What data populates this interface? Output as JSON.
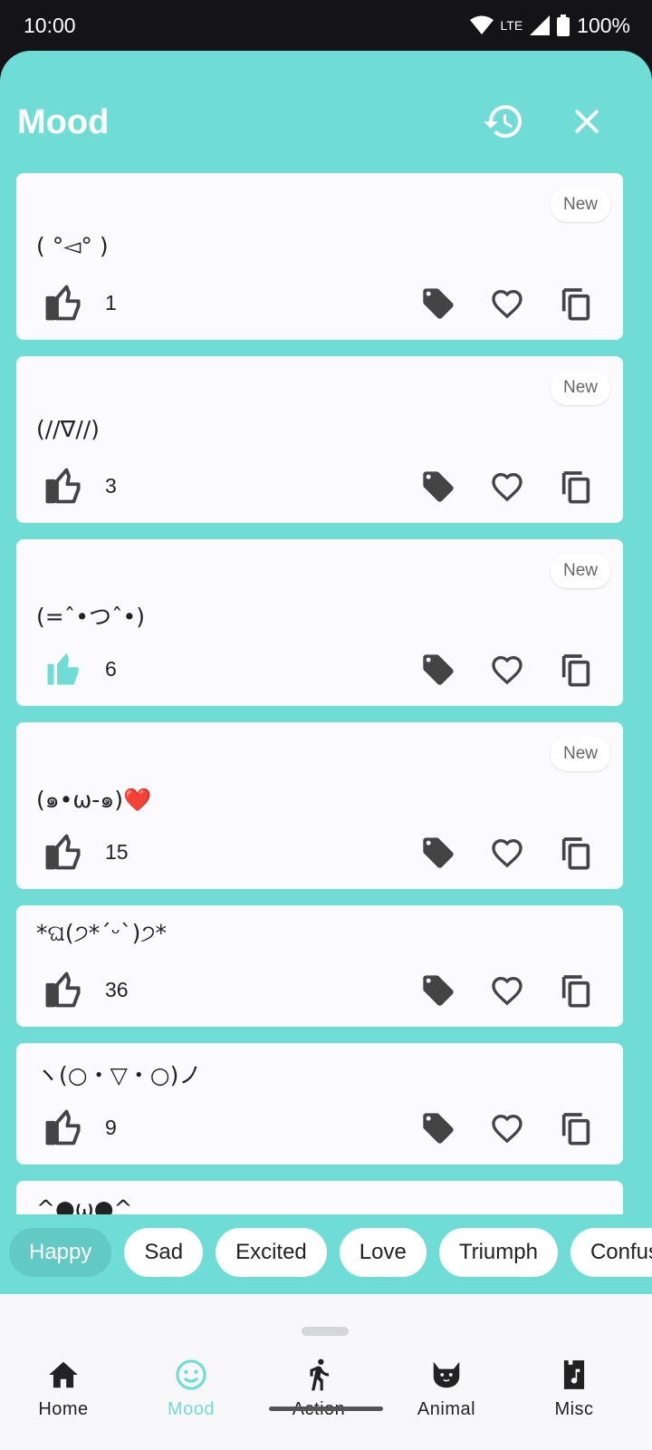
{
  "status": {
    "time": "10:00",
    "network": "LTE",
    "battery": "100%"
  },
  "header": {
    "title": "Mood"
  },
  "accent": "#6fdcd6",
  "cards": [
    {
      "kaomoji": "( °◅° )",
      "likes": "1",
      "badge": "New",
      "liked": false
    },
    {
      "kaomoji": "(//∇//)",
      "likes": "3",
      "badge": "New",
      "liked": false
    },
    {
      "kaomoji": "(=ˆ•つˆ•)",
      "likes": "6",
      "badge": "New",
      "liked": true
    },
    {
      "kaomoji": "(๑•ω-๑)❤️",
      "likes": "15",
      "badge": "New",
      "liked": false
    },
    {
      "kaomoji": "*ଘ(੭*ˊᵕˋ)੭*",
      "likes": "36",
      "liked": false
    },
    {
      "kaomoji": "ヽ(○・▽・○)ノ",
      "likes": "9",
      "liked": false
    },
    {
      "kaomoji": "^●ω●^",
      "liked": false
    }
  ],
  "chips": [
    "Happy",
    "Sad",
    "Excited",
    "Love",
    "Triumph",
    "Confused"
  ],
  "nav": [
    {
      "label": "Home",
      "icon": "home-icon"
    },
    {
      "label": "Mood",
      "icon": "smiley-icon"
    },
    {
      "label": "Action",
      "icon": "running-icon"
    },
    {
      "label": "Animal",
      "icon": "cat-icon"
    },
    {
      "label": "Misc",
      "icon": "music-note-icon"
    }
  ]
}
